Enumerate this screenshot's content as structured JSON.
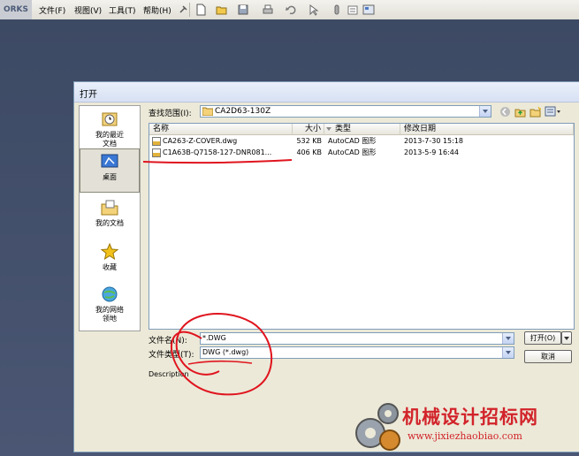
{
  "app": {
    "brand_text": "ORKS",
    "menus": [
      "文件(F)",
      "视图(V)",
      "工具(T)",
      "帮助(H)"
    ]
  },
  "dialog": {
    "title": "打开",
    "look_in_label": "查找范围(I):",
    "look_in_value": "CA2D63-130Z",
    "places": [
      "我的最近\n文档",
      "桌面",
      "我的文档",
      "收藏",
      "我的网络\n领地"
    ],
    "columns": [
      "名称",
      "大小",
      "类型",
      "修改日期"
    ],
    "files": [
      {
        "name": "CA263-Z-COVER.dwg",
        "size": "532 KB",
        "type": "AutoCAD 图形",
        "date": "2013-7-30 15:18"
      },
      {
        "name": "C1A63B-Q7158-127-DNR081...",
        "size": "406 KB",
        "type": "AutoCAD 图形",
        "date": "2013-5-9 16:44"
      }
    ],
    "filename_label": "文件名(N):",
    "filename_value": "*.DWG",
    "filetype_label": "文件类型(T):",
    "filetype_value": "DWG (*.dwg)",
    "description_label": "Description",
    "open_button": "打开(O)",
    "cancel_button": "取消"
  },
  "watermark": {
    "title": "机械设计招标网",
    "url": "www.jixiezhaobiao.com"
  },
  "colors": {
    "accent": "#d2232a",
    "dialog_bg": "#ece9d8",
    "workspace_bg": "#3a4660"
  }
}
